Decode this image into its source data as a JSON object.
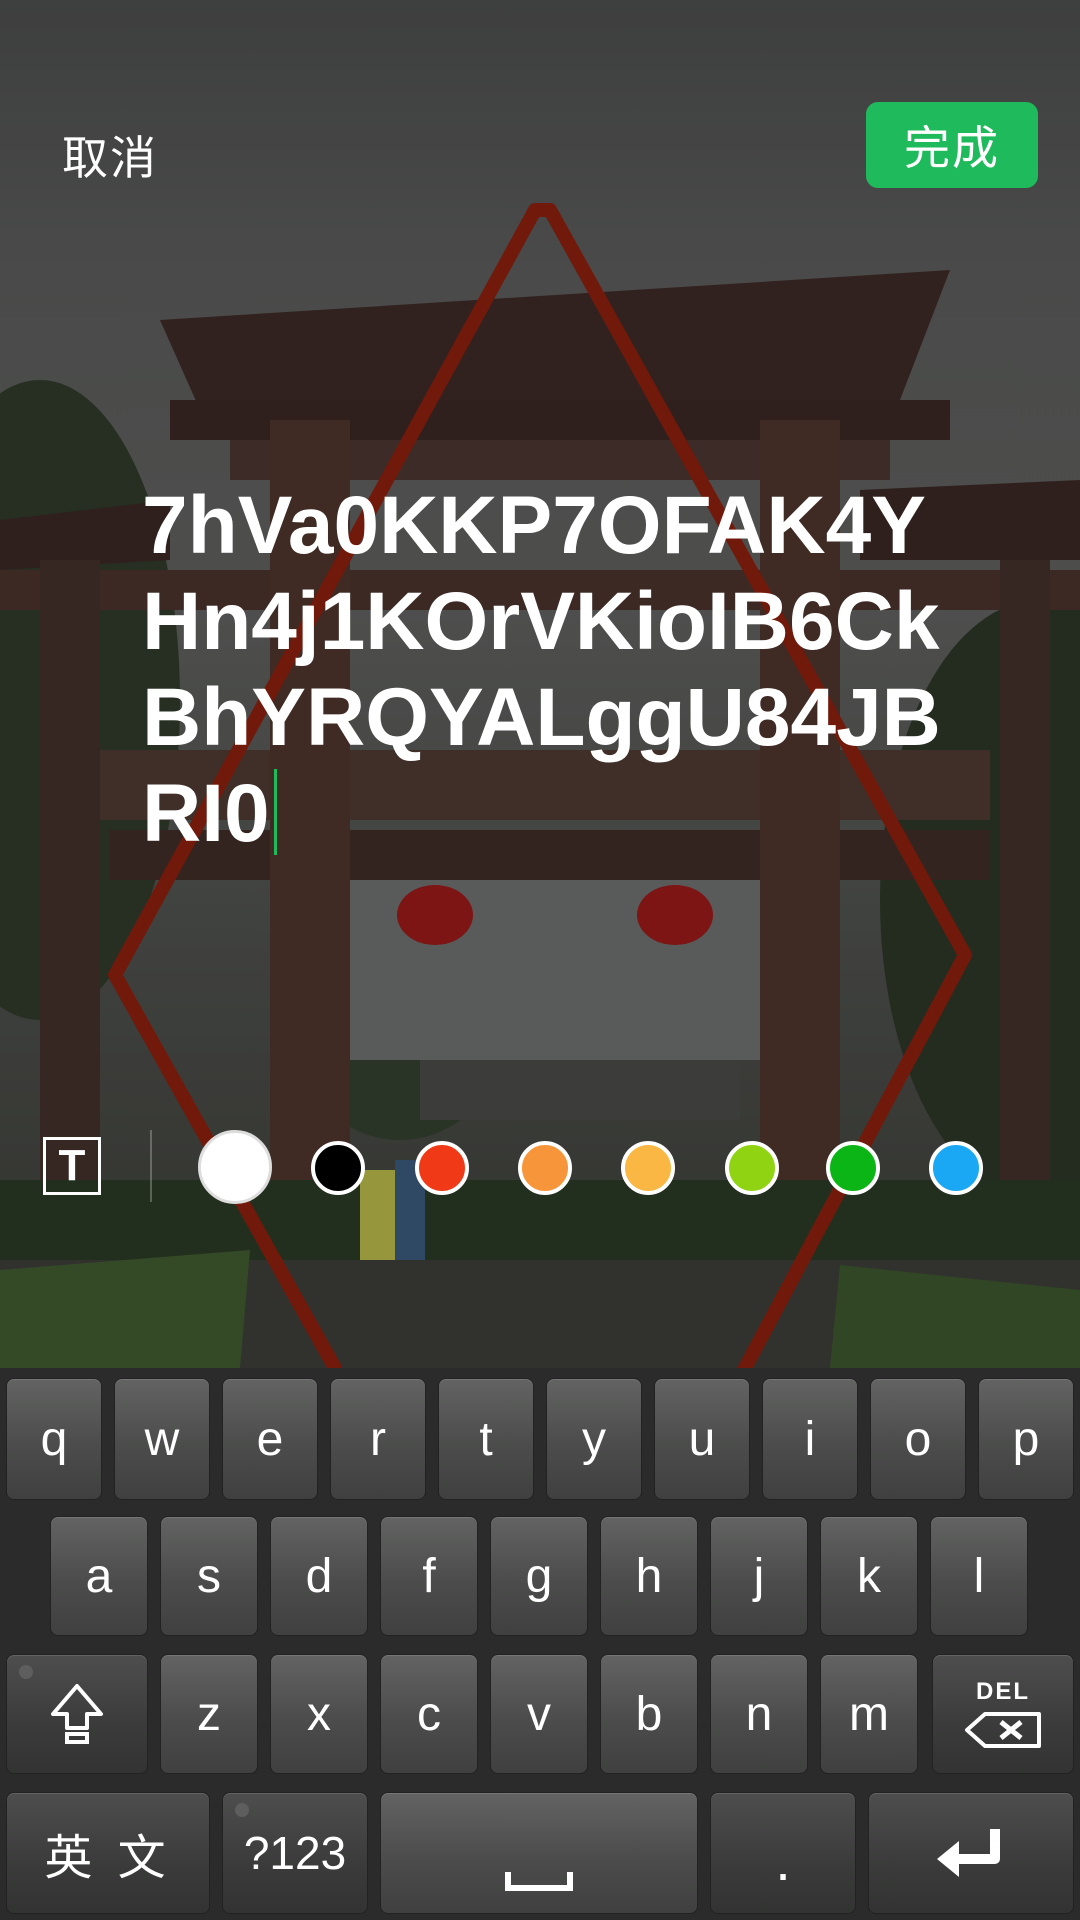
{
  "header": {
    "cancel_label": "取消",
    "done_label": "完成"
  },
  "editor": {
    "lines": [
      "7hVa0KKP7OFAK4Y",
      "Hn4j1KOrVKioIB6Ck",
      "BhYRQYALggU84JB",
      "RI0"
    ]
  },
  "toolbar": {
    "text_style_icon": "T",
    "colors": [
      {
        "name": "white",
        "hex": "#ffffff",
        "selected": true
      },
      {
        "name": "black",
        "hex": "#000000",
        "selected": false
      },
      {
        "name": "red",
        "hex": "#f03a17",
        "selected": false
      },
      {
        "name": "orange",
        "hex": "#f7953a",
        "selected": false
      },
      {
        "name": "yellow",
        "hex": "#fbb743",
        "selected": false
      },
      {
        "name": "light-green",
        "hex": "#8fd313",
        "selected": false
      },
      {
        "name": "green",
        "hex": "#0cb516",
        "selected": false
      },
      {
        "name": "blue",
        "hex": "#1aa8f4",
        "selected": false
      }
    ]
  },
  "keyboard": {
    "row1": [
      "q",
      "w",
      "e",
      "r",
      "t",
      "y",
      "u",
      "i",
      "o",
      "p"
    ],
    "row2": [
      "a",
      "s",
      "d",
      "f",
      "g",
      "h",
      "j",
      "k",
      "l"
    ],
    "row3": [
      "z",
      "x",
      "c",
      "v",
      "b",
      "n",
      "m"
    ],
    "del_label": "DEL",
    "lang_label": "英 文",
    "symbols_label": "?123",
    "period_label": "."
  },
  "colors": {
    "accent": "#1fba5c",
    "drawn_shape": "#8a1f0e"
  }
}
